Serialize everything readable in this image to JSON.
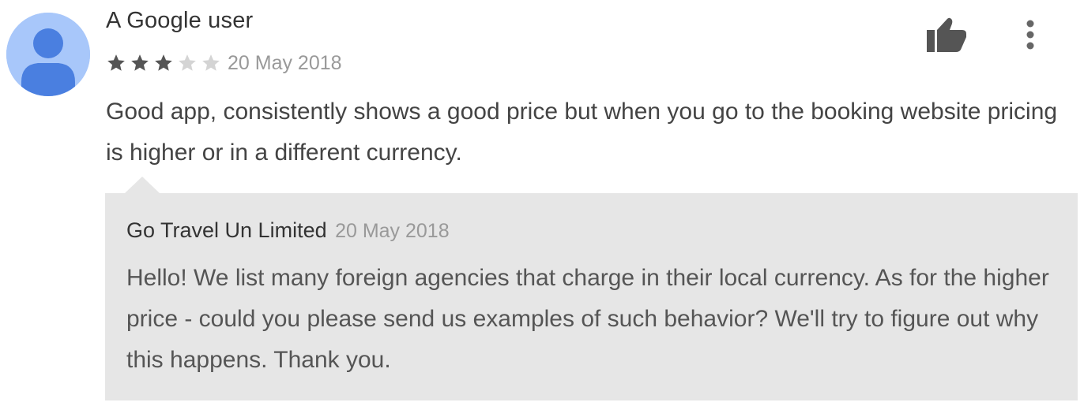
{
  "review": {
    "author": "A Google user",
    "rating": 3,
    "max_rating": 5,
    "date": "20 May 2018",
    "text": "Good app, consistently shows a good price but when you go to the booking website pricing is higher or in a different currency.",
    "avatar_icon": "person-icon",
    "actions": {
      "helpful_icon": "thumbs-up-icon",
      "more_icon": "more-vertical-icon"
    }
  },
  "reply": {
    "author": "Go Travel Un Limited",
    "date": "20 May 2018",
    "text": "Hello! We list many foreign agencies that charge in their local currency. As for the higher price - could you please send us examples of such behavior? We'll try to figure out why this happens. Thank you."
  },
  "colors": {
    "avatar_bg": "#a8c7fa",
    "avatar_figure": "#4a7fe0",
    "star_filled": "#555555",
    "star_empty": "#d4d4d4",
    "reply_bg": "#e6e6e6",
    "icon": "#555555"
  }
}
